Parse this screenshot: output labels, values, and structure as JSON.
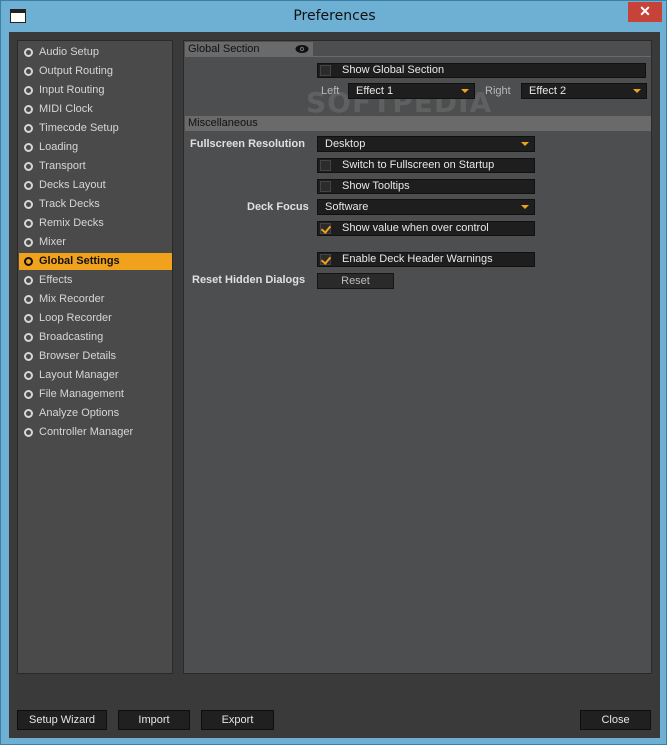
{
  "window": {
    "title": "Preferences"
  },
  "sidebar": {
    "items": [
      {
        "label": "Audio Setup"
      },
      {
        "label": "Output Routing"
      },
      {
        "label": "Input Routing"
      },
      {
        "label": "MIDI Clock"
      },
      {
        "label": "Timecode Setup"
      },
      {
        "label": "Loading"
      },
      {
        "label": "Transport"
      },
      {
        "label": "Decks Layout"
      },
      {
        "label": "Track Decks"
      },
      {
        "label": "Remix Decks"
      },
      {
        "label": "Mixer"
      },
      {
        "label": "Global Settings",
        "selected": true
      },
      {
        "label": "Effects"
      },
      {
        "label": "Mix Recorder"
      },
      {
        "label": "Loop Recorder"
      },
      {
        "label": "Broadcasting"
      },
      {
        "label": "Browser Details"
      },
      {
        "label": "Layout Manager"
      },
      {
        "label": "File Management"
      },
      {
        "label": "Analyze Options"
      },
      {
        "label": "Controller Manager"
      }
    ]
  },
  "global_section": {
    "header": "Global Section",
    "show_global_section": {
      "label": "Show Global Section",
      "checked": false
    },
    "left_label": "Left",
    "left_value": "Effect 1",
    "right_label": "Right",
    "right_value": "Effect 2"
  },
  "misc": {
    "header": "Miscellaneous",
    "fullscreen_label": "Fullscreen Resolution",
    "fullscreen_value": "Desktop",
    "switch_fullscreen": {
      "label": "Switch to Fullscreen on Startup",
      "checked": false
    },
    "show_tooltips": {
      "label": "Show Tooltips",
      "checked": false
    },
    "deck_focus_label": "Deck Focus",
    "deck_focus_value": "Software",
    "show_value": {
      "label": "Show value when over control",
      "checked": true
    },
    "deck_header_warnings": {
      "label": "Enable Deck Header Warnings",
      "checked": true
    },
    "reset_hidden_label": "Reset Hidden Dialogs",
    "reset_button": "Reset"
  },
  "watermark": "SOFTPEDIA",
  "footer": {
    "setup_wizard": "Setup Wizard",
    "import": "Import",
    "export": "Export",
    "close": "Close"
  },
  "colors": {
    "accent": "#f1a21c",
    "panel": "#4d4e4f",
    "background": "#3a3a3a"
  }
}
